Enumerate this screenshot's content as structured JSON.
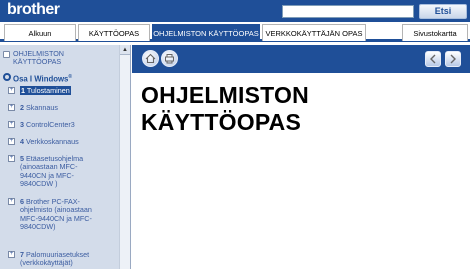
{
  "header": {
    "logo": "brother",
    "search": {
      "placeholder": "",
      "button_label": "Etsi"
    }
  },
  "nav": {
    "tabs": [
      {
        "label": "Alkuun"
      },
      {
        "label": "KÄYTTÖOPAS"
      },
      {
        "label": "OHJELMISTON KÄYTTÖOPAS",
        "active": true
      },
      {
        "label": "VERKKOKÄYTTÄJÄN OPAS"
      },
      {
        "label": "Sivustokartta"
      }
    ]
  },
  "sidebar": {
    "top_item": "OHJELMISTON KÄYTTÖOPAS",
    "section": {
      "label": "Osa I Windows",
      "superscript": "®"
    },
    "items": [
      {
        "num": "1",
        "label": "Tulostaminen",
        "selected": true
      },
      {
        "num": "2",
        "label": "Skannaus"
      },
      {
        "num": "3",
        "label": "ControlCenter3"
      },
      {
        "num": "4",
        "label": "Verkkoskannaus"
      },
      {
        "num": "5",
        "label": "Etäasetusohjelma (ainoastaan MFC-9440CN ja MFC-9840CDW )"
      },
      {
        "num": "6",
        "label": "Brother PC-FAX-ohjelmisto (ainoastaan MFC-9440CN ja MFC-9840CDW)"
      },
      {
        "num": "7",
        "label": "Palomuuriasetukset (verkkokäyttäjät)"
      }
    ]
  },
  "content": {
    "title_line1": "OHJELMISTON",
    "title_line2": "KÄYTTÖOPAS"
  },
  "colors": {
    "brand": "#1f4f98",
    "sidebar_bg": "#d3dcea",
    "link": "#3b5ca0"
  },
  "icons": [
    "home-icon",
    "print-icon",
    "prev-page-icon",
    "next-page-icon"
  ]
}
